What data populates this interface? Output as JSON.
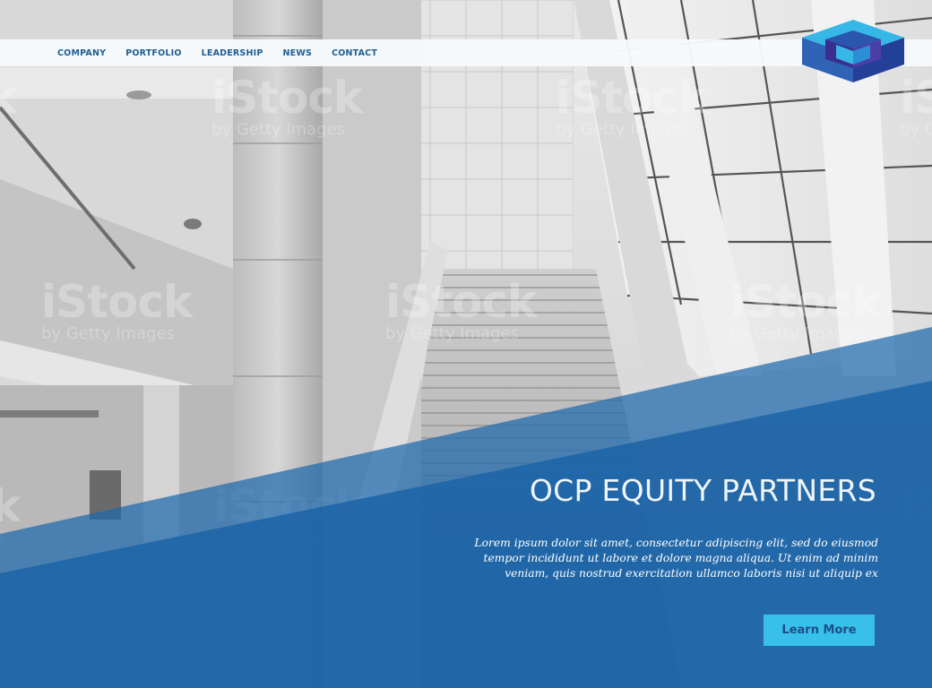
{
  "nav": {
    "items": [
      "COMPANY",
      "PORTFOLIO",
      "LEADERSHIP",
      "NEWS",
      "CONTACT"
    ]
  },
  "logo": {
    "icon": "cube-logo-icon"
  },
  "hero": {
    "headline": "OCP EQUITY PARTNERS",
    "body": "Lorem ipsum dolor sit amet, consectetur adipiscing elit, sed do eiusmod tempor incididunt ut labore et dolore magna aliqua. Ut enim ad minim veniam, quis nostrud exercitation ullamco laboris nisi ut aliquip ex",
    "cta_label": "Learn More"
  },
  "watermark": {
    "brand": "iStock",
    "tagline": "by Getty Images"
  },
  "colors": {
    "nav_text": "#1f5e93",
    "overlay_blue": "#1d66a8",
    "cta_bg": "#38c0ea",
    "cta_text": "#1b4f86"
  }
}
